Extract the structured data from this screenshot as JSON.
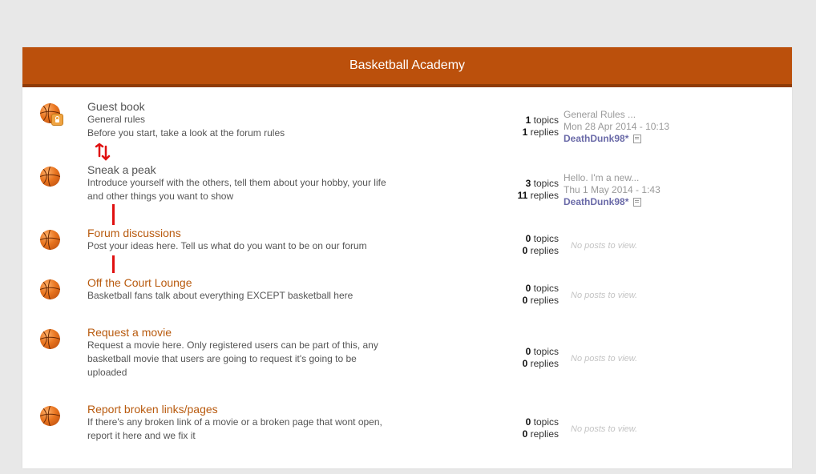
{
  "header": {
    "title": "Basketball Academy"
  },
  "forums": [
    {
      "title": "Guest book",
      "subtitle": "General rules",
      "description": "Before you start, take a look at the forum rules",
      "topics": "1",
      "topics_label": "topics",
      "replies": "1",
      "replies_label": "replies",
      "last_post": {
        "title": "General Rules ...",
        "date": "Mon 28 Apr 2014 - 10:13",
        "user": "DeathDunk98*"
      }
    },
    {
      "title": "Sneak a peak",
      "description": "Introduce yourself with the others, tell them about your hobby, your life and other things you want to show",
      "topics": "3",
      "topics_label": "topics",
      "replies": "11",
      "replies_label": "replies",
      "last_post": {
        "title": "Hello. I'm a new...",
        "date": "Thu 1 May 2014 - 1:43",
        "user": "DeathDunk98*"
      }
    },
    {
      "title": "Forum discussions",
      "description": "Post your ideas here. Tell us what do you want to be on our forum",
      "topics": "0",
      "topics_label": "topics",
      "replies": "0",
      "replies_label": "replies",
      "no_posts": "No posts to view."
    },
    {
      "title": "Off the Court Lounge",
      "description": "Basketball fans talk about everything EXCEPT basketball here",
      "topics": "0",
      "topics_label": "topics",
      "replies": "0",
      "replies_label": "replies",
      "no_posts": "No posts to view."
    },
    {
      "title": "Request a movie",
      "description": "Request a movie here. Only registered users can be part of this, any basketball movie that users are going to request it's going to be uploaded",
      "topics": "0",
      "topics_label": "topics",
      "replies": "0",
      "replies_label": "replies",
      "no_posts": "No posts to view."
    },
    {
      "title": "Report broken links/pages",
      "description": "If there's any broken link of a movie or a broken page that wont open, report it here and we fix it",
      "topics": "0",
      "topics_label": "topics",
      "replies": "0",
      "replies_label": "replies",
      "no_posts": "No posts to view."
    }
  ],
  "colors": {
    "header_bg": "#bb500c",
    "link": "#b85a0e",
    "annotation": "#e01010"
  },
  "icons": {
    "forum": "basketball-icon",
    "locked": "lock-icon",
    "last_post": "document-icon"
  }
}
